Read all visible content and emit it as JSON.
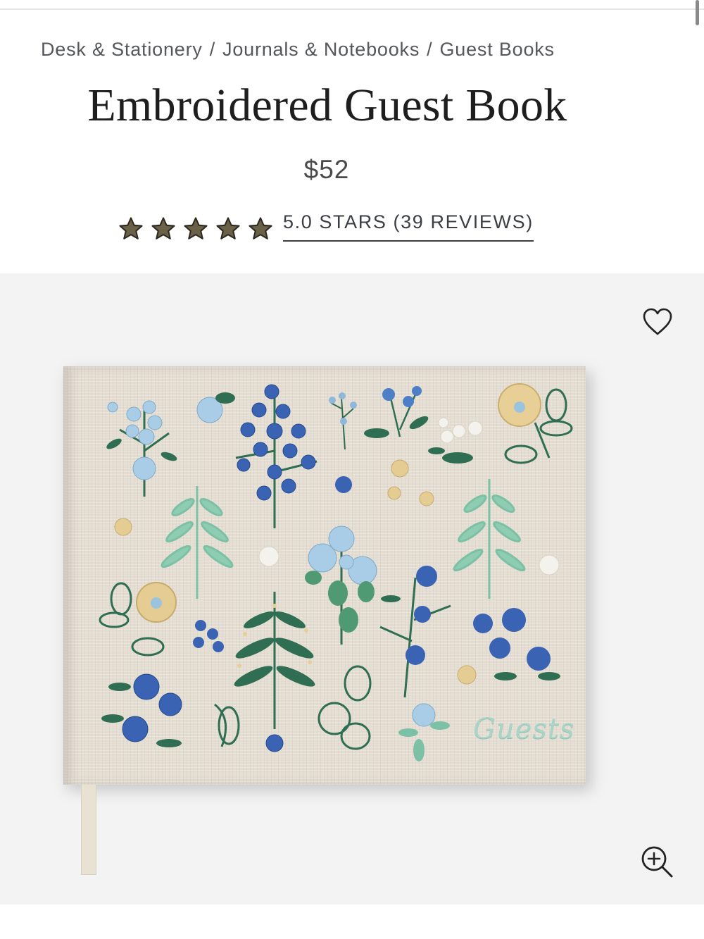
{
  "breadcrumb": {
    "items": [
      "Desk & Stationery",
      "Journals & Notebooks",
      "Guest Books"
    ],
    "separator": "/"
  },
  "product": {
    "title": "Embroidered Guest Book",
    "price": "$52",
    "rating": {
      "stars_filled": 5,
      "stars_total": 5,
      "link_text": "5.0 STARS (39 REVIEWS)"
    },
    "cover_text": "Guests"
  },
  "icons": {
    "star": "star-icon",
    "wishlist": "heart-outline-icon",
    "zoom": "zoom-in-icon"
  },
  "colors": {
    "star_fill": "#6b6146",
    "text_dark": "#1e1e1e",
    "gallery_bg": "#f3f3f3",
    "linen": "#e4ddd2"
  }
}
